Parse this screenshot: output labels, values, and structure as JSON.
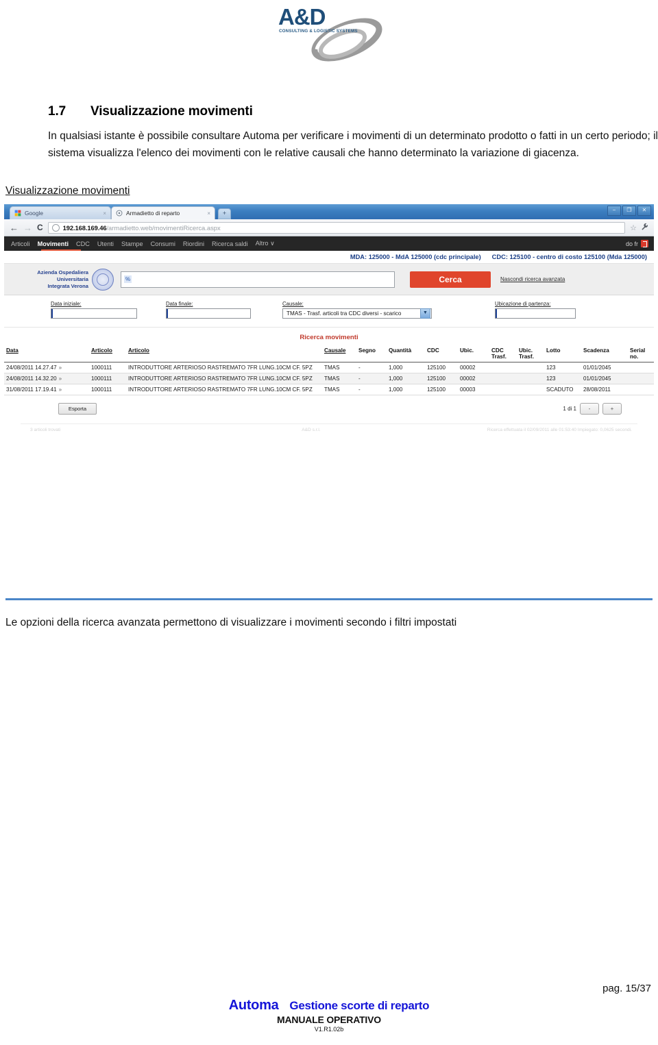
{
  "logo": {
    "name": "A&D",
    "tagline": "CONSULTING & LOGISTIC SYSTEMS"
  },
  "document": {
    "section_number": "1.7",
    "section_title": "Visualizzazione movimenti",
    "paragraph": "In qualsiasi istante è possibile consultare Automa per verificare i movimenti di un determinato prodotto o fatti in un certo periodo; il sistema visualizza l'elenco dei movimenti con le relative causali che hanno determinato la variazione di giacenza.",
    "figure_caption": "Visualizzazione movimenti",
    "trailing_paragraph": "Le opzioni della ricerca avanzata permettono di visualizzare i movimenti secondo i filtri impostati"
  },
  "browser": {
    "tabs": [
      {
        "title": "Google",
        "active": false,
        "close": "×"
      },
      {
        "title": "Armadietto di reparto",
        "active": true,
        "close": "×"
      }
    ],
    "new_tab_label": "+",
    "window_buttons": [
      "−",
      "❐",
      "✕"
    ],
    "nav": {
      "back": "←",
      "forward": "→",
      "reload": "C"
    },
    "url": {
      "host": "192.168.169.46",
      "path": "/armadietto.web/movimentiRicerca.aspx"
    },
    "star_icon": "☆",
    "wrench_icon": "🔧"
  },
  "app": {
    "menu": [
      {
        "label": "Articoli",
        "active": false
      },
      {
        "label": "Movimenti",
        "active": true
      },
      {
        "label": "CDC",
        "active": false
      },
      {
        "label": "Utenti",
        "active": false
      },
      {
        "label": "Stampe",
        "active": false
      },
      {
        "label": "Consumi",
        "active": false
      },
      {
        "label": "Riordini",
        "active": false
      },
      {
        "label": "Ricerca saldi",
        "active": false
      },
      {
        "label": "Altro ∨",
        "active": false
      }
    ],
    "user_label": "do fr",
    "context": {
      "mda": "MDA: 125000 - MdA 125000 (cdc principale)",
      "cdc": "CDC: 125100 - centro di costo 125100 (Mda 125000)"
    },
    "hospital": {
      "line1": "Azienda Ospedaliera",
      "line2": "Universitaria",
      "line3": "Integrata Verona"
    },
    "search": {
      "value": "%",
      "button_label": "Cerca",
      "toggle_link": "Nascondi ricerca avanzata"
    },
    "filters": [
      {
        "label": "Data iniziale:",
        "value": "",
        "type": "text"
      },
      {
        "label": "Data finale:",
        "value": "",
        "type": "text"
      },
      {
        "label": "Causale:",
        "value": "TMAS - Trasf. articoli tra CDC diversi - scarico",
        "type": "select"
      },
      {
        "label": "Ubicazione di partenza:",
        "value": "",
        "type": "text"
      }
    ],
    "results": {
      "title": "Ricerca movimenti",
      "columns": [
        "Data",
        "Articolo",
        "Articolo",
        "Causale",
        "Segno",
        "Quantità",
        "CDC",
        "Ubic.",
        "CDC Trasf.",
        "Ubic. Trasf.",
        "Lotto",
        "Scadenza",
        "Serial no."
      ],
      "rows": [
        {
          "data": "24/08/2011 14.27.47",
          "chevron": "»",
          "codice": "1000111",
          "articolo": "INTRODUTTORE ARTERIOSO RASTREMATO 7FR LUNG.10CM CF. 5PZ",
          "causale": "TMAS",
          "segno": "-",
          "quantita": "1,000",
          "cdc": "125100",
          "ubic": "00002",
          "cdc_trasf": "",
          "ubic_trasf": "",
          "lotto": "123",
          "scadenza": "01/01/2045",
          "serial": ""
        },
        {
          "data": "24/08/2011 14.32.20",
          "chevron": "»",
          "codice": "1000111",
          "articolo": "INTRODUTTORE ARTERIOSO RASTREMATO 7FR LUNG.10CM CF. 5PZ",
          "causale": "TMAS",
          "segno": "-",
          "quantita": "1,000",
          "cdc": "125100",
          "ubic": "00002",
          "cdc_trasf": "",
          "ubic_trasf": "",
          "lotto": "123",
          "scadenza": "01/01/2045",
          "serial": ""
        },
        {
          "data": "31/08/2011 17.19.41",
          "chevron": "»",
          "codice": "1000111",
          "articolo": "INTRODUTTORE ARTERIOSO RASTREMATO 7FR LUNG.10CM CF. 5PZ",
          "causale": "TMAS",
          "segno": "-",
          "quantita": "1,000",
          "cdc": "125100",
          "ubic": "00003",
          "cdc_trasf": "",
          "ubic_trasf": "",
          "lotto": "SCADUTO",
          "scadenza": "28/08/2011",
          "serial": ""
        }
      ],
      "export_label": "Esporta",
      "pager": {
        "text": "1 di 1",
        "prev": "-",
        "next": "+"
      },
      "status_left": "3 articoli trovati",
      "status_center": "A&D s.r.l.",
      "status_right": "Ricerca effettuata il 02/09/2011 alle 01:53:40 Impiegato: 0,0625 secondi."
    }
  },
  "page_footer": {
    "page_number": "pag. 15/37",
    "brand": "Automa",
    "tagline": "Gestione scorte di reparto",
    "manual": "MANUALE OPERATIVO",
    "version": "V1.R1.02b"
  },
  "colors": {
    "brand_blue": "#1f4e79",
    "accent_red": "#e0452c",
    "nav_dark": "#262626",
    "hrule_blue": "#4a86c8",
    "footer_blue": "#1414d8"
  }
}
